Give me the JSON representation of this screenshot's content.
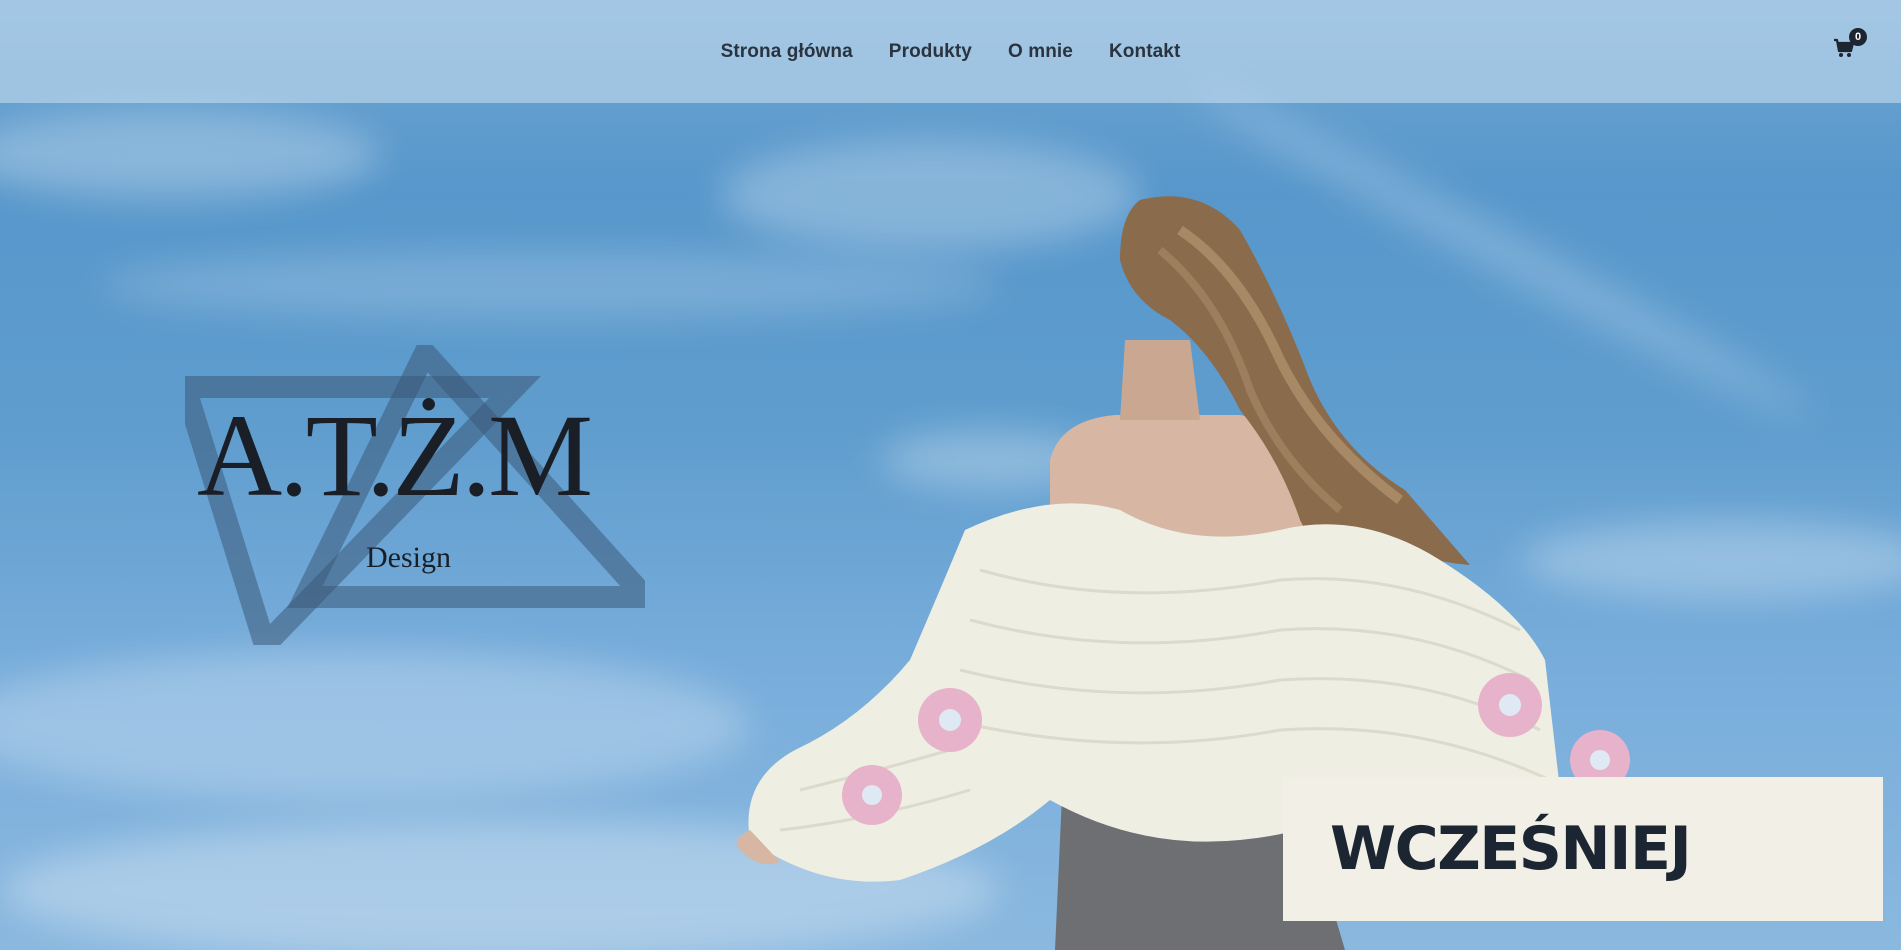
{
  "nav": {
    "items": [
      {
        "label": "Strona główna"
      },
      {
        "label": "Produkty"
      },
      {
        "label": "O mnie"
      },
      {
        "label": "Kontakt"
      }
    ],
    "cart_count": "0",
    "cart_icon": "shopping-cart-icon"
  },
  "logo": {
    "text": "A.T.Ż.M",
    "sub": "Design"
  },
  "hero": {
    "button_label": "WCZEŚNIEJ"
  },
  "colors": {
    "sky": "#5a9acb",
    "text_dark": "#1c2632",
    "button_bg": "#f1efe6",
    "navbar_bg": "#cde1f0"
  }
}
